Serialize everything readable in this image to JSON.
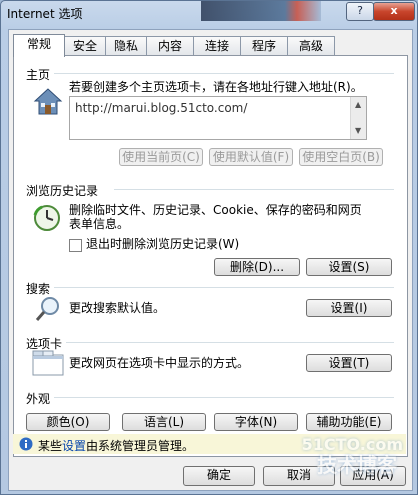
{
  "window": {
    "title": "Internet 选项",
    "help_label": "?",
    "close_label": "x"
  },
  "tabs": [
    "常规",
    "安全",
    "隐私",
    "内容",
    "连接",
    "程序",
    "高级"
  ],
  "home": {
    "heading": "主页",
    "desc": "若要创建多个主页选项卡，请在各地址行键入地址(R)。",
    "url": "http://marui.blog.51cto.com/",
    "btn_current": "使用当前页(C)",
    "btn_default": "使用默认值(F)",
    "btn_blank": "使用空白页(B)"
  },
  "history": {
    "heading": "浏览历史记录",
    "desc1": "删除临时文件、历史记录、Cookie、保存的密码和网页",
    "desc2": "表单信息。",
    "checkbox_label": "退出时删除浏览历史记录(W)",
    "btn_delete": "删除(D)...",
    "btn_settings": "设置(S)"
  },
  "search": {
    "heading": "搜索",
    "desc": "更改搜索默认值。",
    "btn_settings": "设置(I)"
  },
  "tabsec": {
    "heading": "选项卡",
    "desc": "更改网页在选项卡中显示的方式。",
    "btn_settings": "设置(T)"
  },
  "appearance": {
    "heading": "外观",
    "btn_colors": "颜色(O)",
    "btn_languages": "语言(L)",
    "btn_fonts": "字体(N)",
    "btn_accessibility": "辅助功能(E)"
  },
  "info": {
    "prefix": "某些",
    "link": "设置",
    "suffix": "由系统管理员管理。"
  },
  "footer": {
    "ok": "确定",
    "cancel": "取消",
    "apply": "应用(A)"
  },
  "watermark": {
    "top": "51CTO.com",
    "bottom": "技术博客"
  }
}
